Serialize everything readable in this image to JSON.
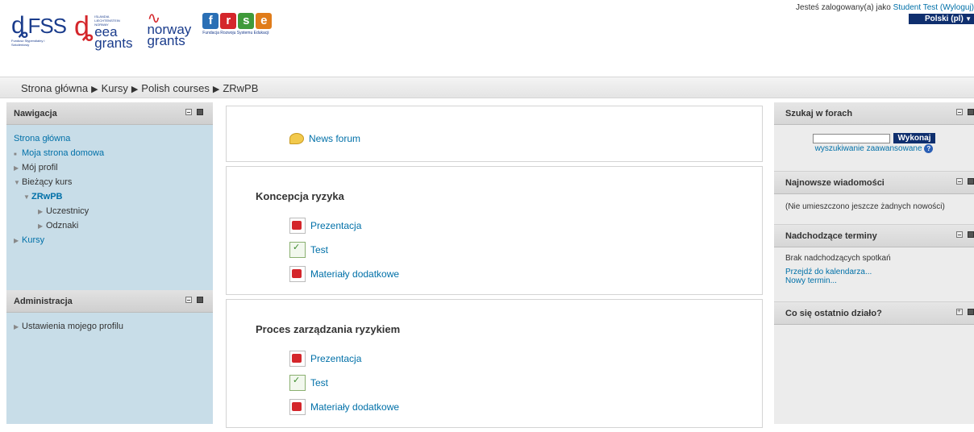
{
  "header": {
    "logos": {
      "fss": "FSS",
      "fss_sub": "Fundusz Stypendialny i Szkoleniowy",
      "eea_small": "ISLANDIA LIECHTENSTEIN NORWAY",
      "eea_line1": "eea",
      "eea_line2": "grants",
      "norway_line1": "norway",
      "norway_line2": "grants",
      "frse_letters": [
        "f",
        "r",
        "s",
        "e"
      ],
      "frse_sub": "Fundacja Rozwoju Systemu Edukacji"
    },
    "login_prefix": "Jesteś zalogowany(a) jako ",
    "login_user": "Student Test",
    "login_logout": "(Wyloguj)",
    "language": "Polski (pl)"
  },
  "breadcrumb": [
    "Strona główna",
    "Kursy",
    "Polish courses",
    "ZRwPB"
  ],
  "navigation": {
    "title": "Nawigacja",
    "items": [
      {
        "label": "Strona główna"
      },
      {
        "label": "Moja strona domowa"
      },
      {
        "label": "Mój profil"
      },
      {
        "label": "Bieżący kurs"
      },
      {
        "label": "ZRwPB"
      },
      {
        "label": "Uczestnicy"
      },
      {
        "label": "Odznaki"
      },
      {
        "label": "Kursy"
      }
    ]
  },
  "administration": {
    "title": "Administracja",
    "items": [
      {
        "label": "Ustawienia mojego profilu"
      }
    ]
  },
  "main": {
    "sections": [
      {
        "title": "",
        "activities": [
          {
            "label": "News forum",
            "icon": "forum-icon"
          }
        ]
      },
      {
        "title": "Koncepcja ryzyka",
        "activities": [
          {
            "label": "Prezentacja",
            "icon": "pdf-icon"
          },
          {
            "label": "Test",
            "icon": "quiz-icon"
          },
          {
            "label": "Materiały dodatkowe",
            "icon": "pdf-icon"
          }
        ]
      },
      {
        "title": "Proces zarządzania ryzykiem",
        "activities": [
          {
            "label": "Prezentacja",
            "icon": "pdf-icon"
          },
          {
            "label": "Test",
            "icon": "quiz-icon"
          },
          {
            "label": "Materiały dodatkowe",
            "icon": "pdf-icon"
          }
        ]
      }
    ]
  },
  "right": {
    "search": {
      "title": "Szukaj w forach",
      "button": "Wykonaj",
      "advanced": "wyszukiwanie zaawansowane"
    },
    "news": {
      "title": "Najnowsze wiadomości",
      "text": "(Nie umieszczono jeszcze żadnych nowości)"
    },
    "upcoming": {
      "title": "Nadchodzące terminy",
      "text": "Brak nadchodzących spotkań",
      "link1": "Przejdź do kalendarza...",
      "link2": "Nowy termin..."
    },
    "recent": {
      "title": "Co się ostatnio działo?"
    }
  },
  "colors": {
    "link": "#0070a8",
    "left_block_bg": "#c8dde8",
    "button_bg": "#0f2f6e",
    "eea_red": "#d4262b",
    "eea_blue": "#1a3c8c",
    "frse_f": "#2a6fb5",
    "frse_r": "#d4262b",
    "frse_s": "#3f9a3a",
    "frse_e": "#e07c1a"
  }
}
